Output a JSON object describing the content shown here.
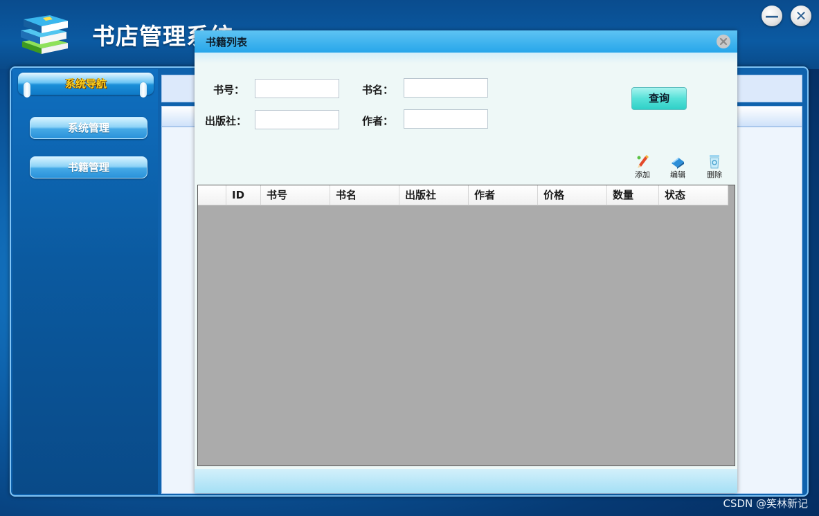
{
  "app": {
    "title": "书店管理系统"
  },
  "window_controls": {
    "minimize": "—",
    "close": "✕"
  },
  "sidebar": {
    "header": "系统导航",
    "items": [
      {
        "label": "系统管理"
      },
      {
        "label": "书籍管理"
      }
    ]
  },
  "dialog": {
    "title": "书籍列表",
    "close_icon": "close-icon",
    "form": {
      "book_no_label": "书号：",
      "book_name_label": "书名：",
      "publisher_label": "出版社：",
      "author_label": "作者：",
      "book_no_value": "",
      "book_name_value": "",
      "publisher_value": "",
      "author_value": ""
    },
    "query_button": "查询",
    "toolbar": [
      {
        "label": "添加",
        "icon": "pencil-add-icon"
      },
      {
        "label": "编辑",
        "icon": "edit-icon"
      },
      {
        "label": "删除",
        "icon": "trash-icon"
      }
    ],
    "table": {
      "columns": [
        "ID",
        "书号",
        "书名",
        "出版社",
        "作者",
        "价格",
        "数量",
        "状态"
      ],
      "rows": []
    }
  },
  "watermark": "CSDN @笑林新记",
  "colors": {
    "dialog_title_bar": "#27a6ea",
    "query_button": "#56e1d8",
    "grid_background": "#ababab",
    "nav_header_text": "#ffd21e"
  }
}
